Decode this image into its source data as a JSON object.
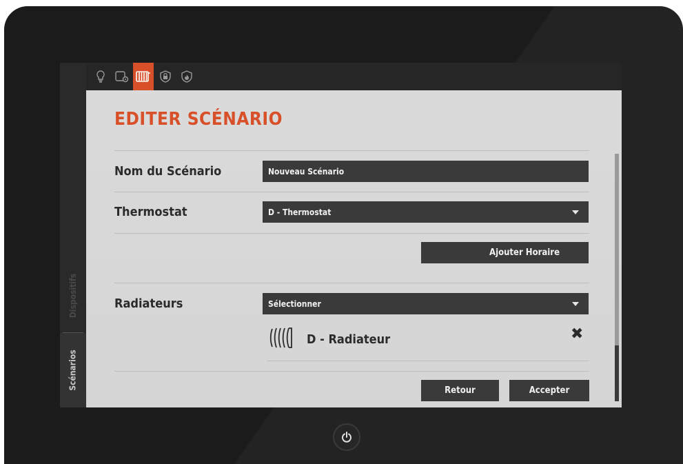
{
  "sidebar": {
    "tabs": [
      {
        "label": "Dispositifs",
        "active": false
      },
      {
        "label": "Scénarios",
        "active": true
      }
    ]
  },
  "iconbar": {
    "icons": [
      "lightbulb-icon",
      "device-settings-icon",
      "radiator-icon",
      "security-icon",
      "fire-icon"
    ],
    "active_icon": "radiator-icon",
    "accent_color": "#d8502a"
  },
  "form": {
    "title": "EDITER SCÉNARIO",
    "name_label": "Nom du Scénario",
    "name_value": "Nouveau Scénario",
    "thermostat_label": "Thermostat",
    "thermostat_value": "D - Thermostat",
    "add_schedule_label": "Ajouter Horaire",
    "radiators_label": "Radiateurs",
    "radiators_select": "Sélectionner",
    "radiator_item": "D - Radiateur",
    "back_label": "Retour",
    "accept_label": "Accepter"
  }
}
